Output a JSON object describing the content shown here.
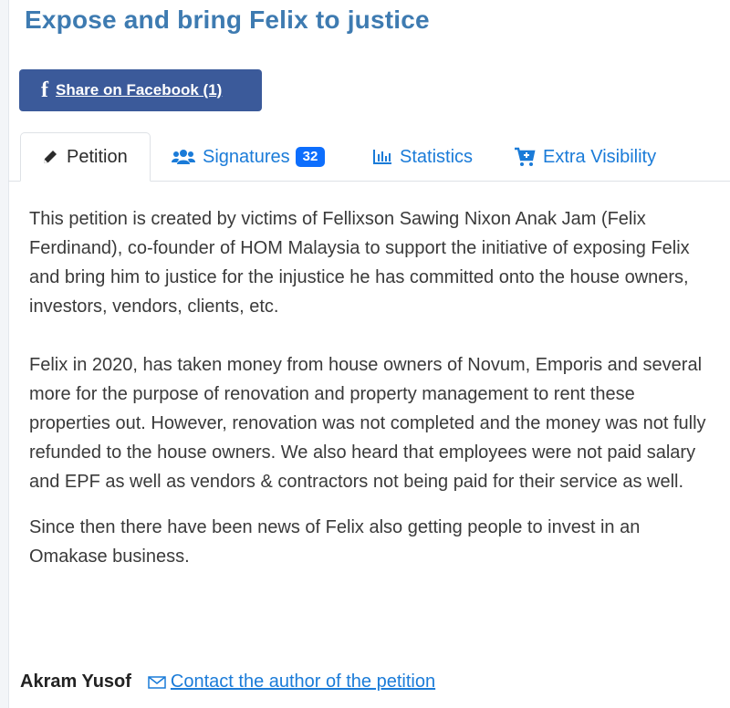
{
  "title": "Expose and bring Felix to justice",
  "share": {
    "icon": "facebook-icon",
    "label": "Share on Facebook (1)"
  },
  "tabs": [
    {
      "icon": "pencil-icon",
      "label": "Petition",
      "active": true
    },
    {
      "icon": "users-icon",
      "label": "Signatures",
      "count": "32"
    },
    {
      "icon": "bar-chart-icon",
      "label": "Statistics"
    },
    {
      "icon": "cart-plus-icon",
      "label": "Extra Visibility"
    }
  ],
  "body": {
    "paragraphs": [
      "This petition is created by victims of Fellixson Sawing Nixon Anak Jam (Felix Ferdinand), co-founder of HOM Malaysia to support the initiative of exposing Felix and bring him to justice for the injustice he has committed onto the house owners, investors, vendors, clients, etc.",
      "Felix in 2020, has taken money from house owners of Novum, Emporis and several more for the purpose of renovation and property management to rent these properties out. However, renovation was not completed and the money was not fully refunded to the house owners. We also heard that employees were not paid salary and EPF as well as vendors & contractors not being paid for their service as well.",
      "Since then there have been news of Felix also getting people to invest in an Omakase business."
    ]
  },
  "author": {
    "name": "Akram Yusof",
    "contact_icon": "envelope-icon",
    "contact_label": "Contact the author of the petition"
  },
  "colors": {
    "title": "#3e7bb1",
    "facebook": "#3b5a9a",
    "link": "#1a7bd8",
    "badge": "#0d6efd"
  }
}
